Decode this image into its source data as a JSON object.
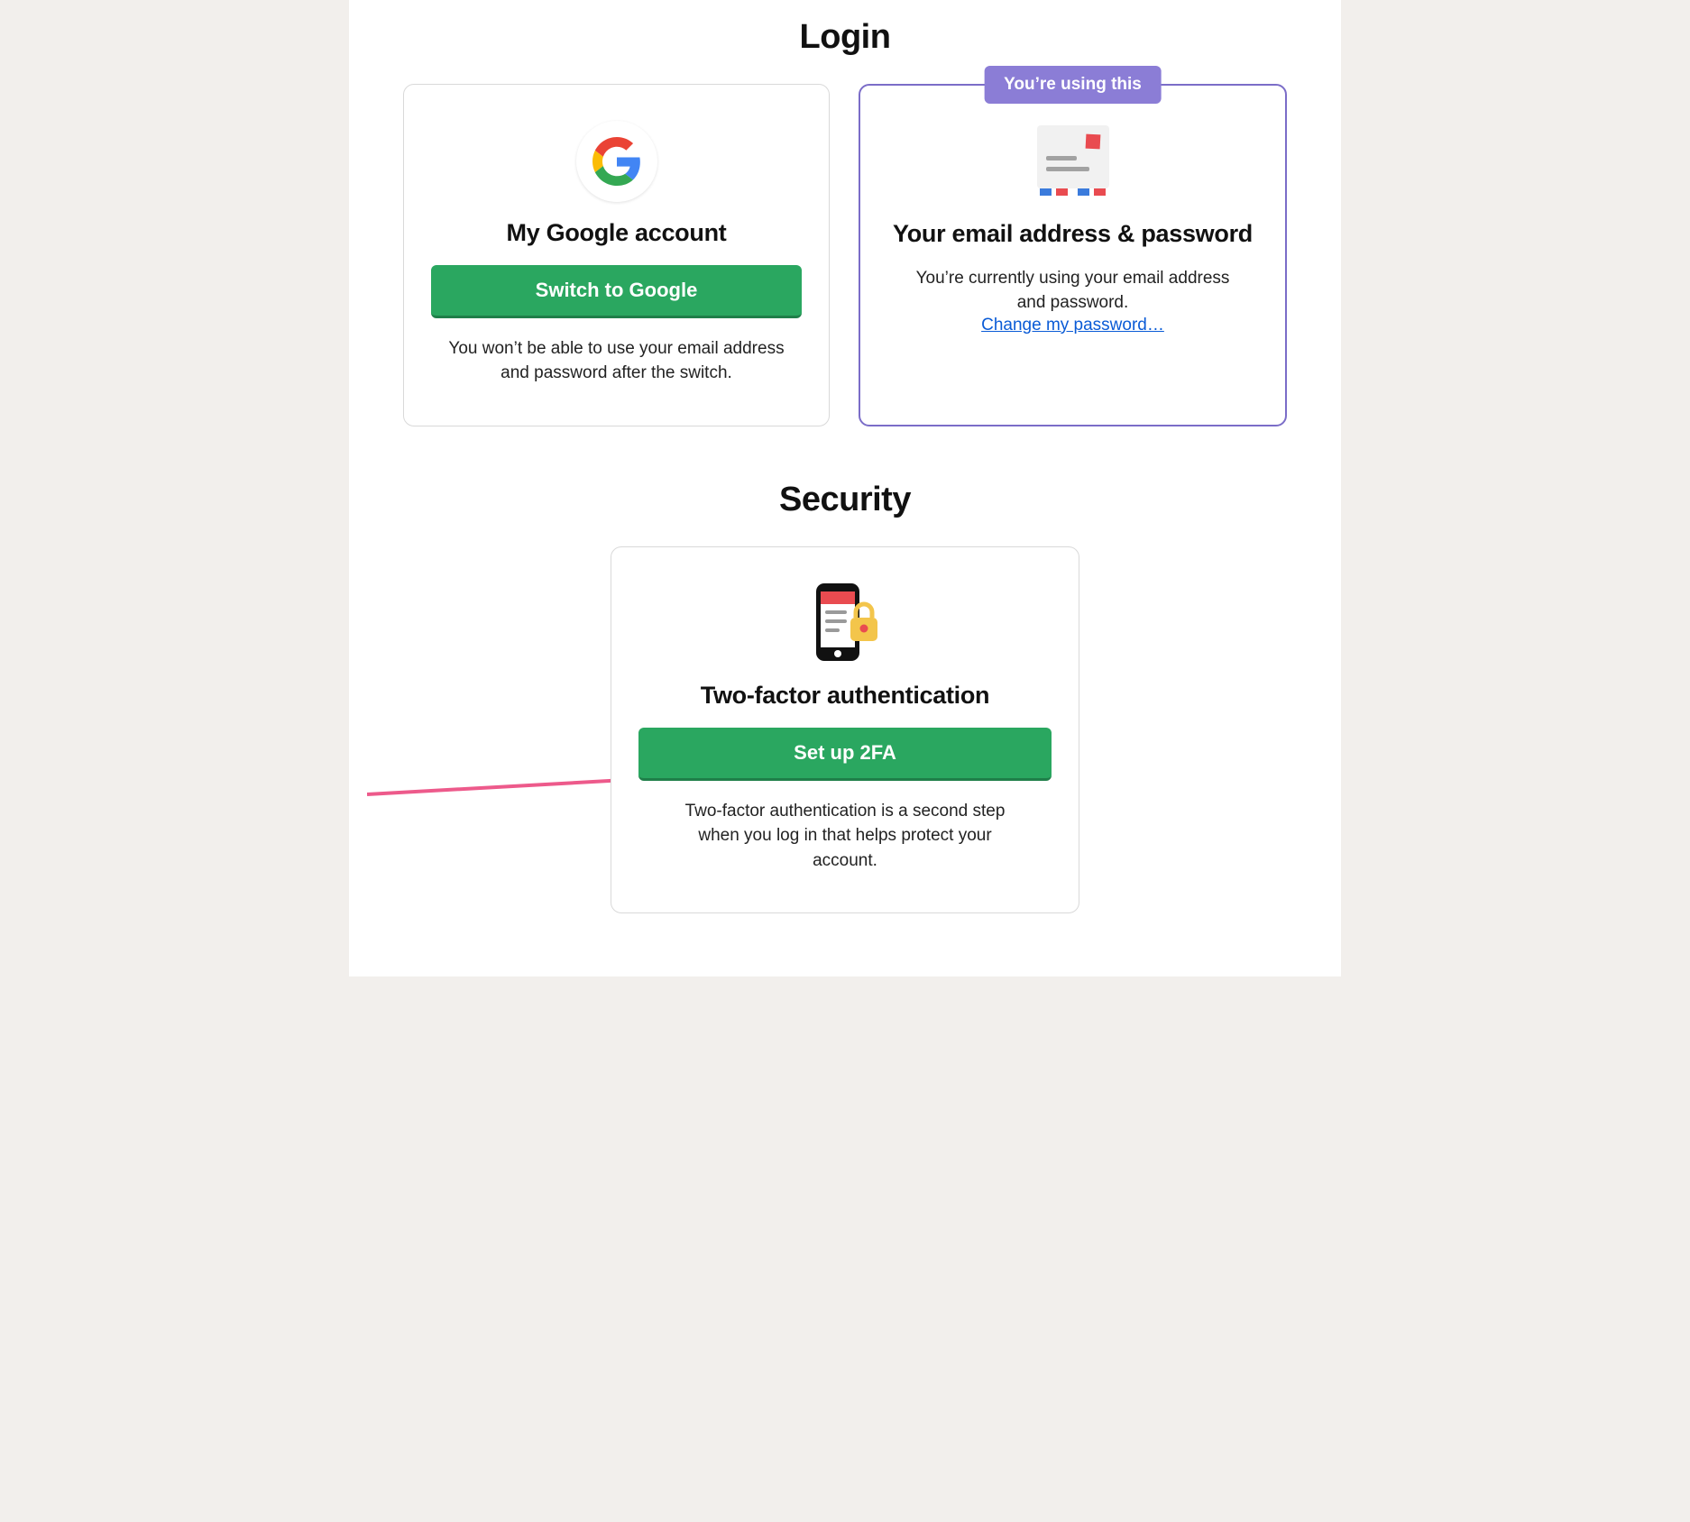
{
  "login": {
    "section_title": "Login",
    "google_card": {
      "title": "My Google account",
      "button_label": "Switch to Google",
      "description": "You won’t be able to use your email address and password after the switch."
    },
    "email_card": {
      "badge": "You’re using this",
      "title": "Your email address & password",
      "description": "You’re currently using your email address and password.",
      "change_link_label": "Change my password…"
    }
  },
  "security": {
    "section_title": "Security",
    "twofa_card": {
      "title": "Two-factor authentication",
      "button_label": "Set up 2FA",
      "description": "Two-factor authentication is a second step when you log in that helps protect your account."
    }
  },
  "colors": {
    "button_green": "#2aa760",
    "badge_purple": "#8b7dd6",
    "active_border": "#7b6dc8",
    "link_blue": "#0a5bd6",
    "annotation_pink": "#ed5a8b"
  }
}
